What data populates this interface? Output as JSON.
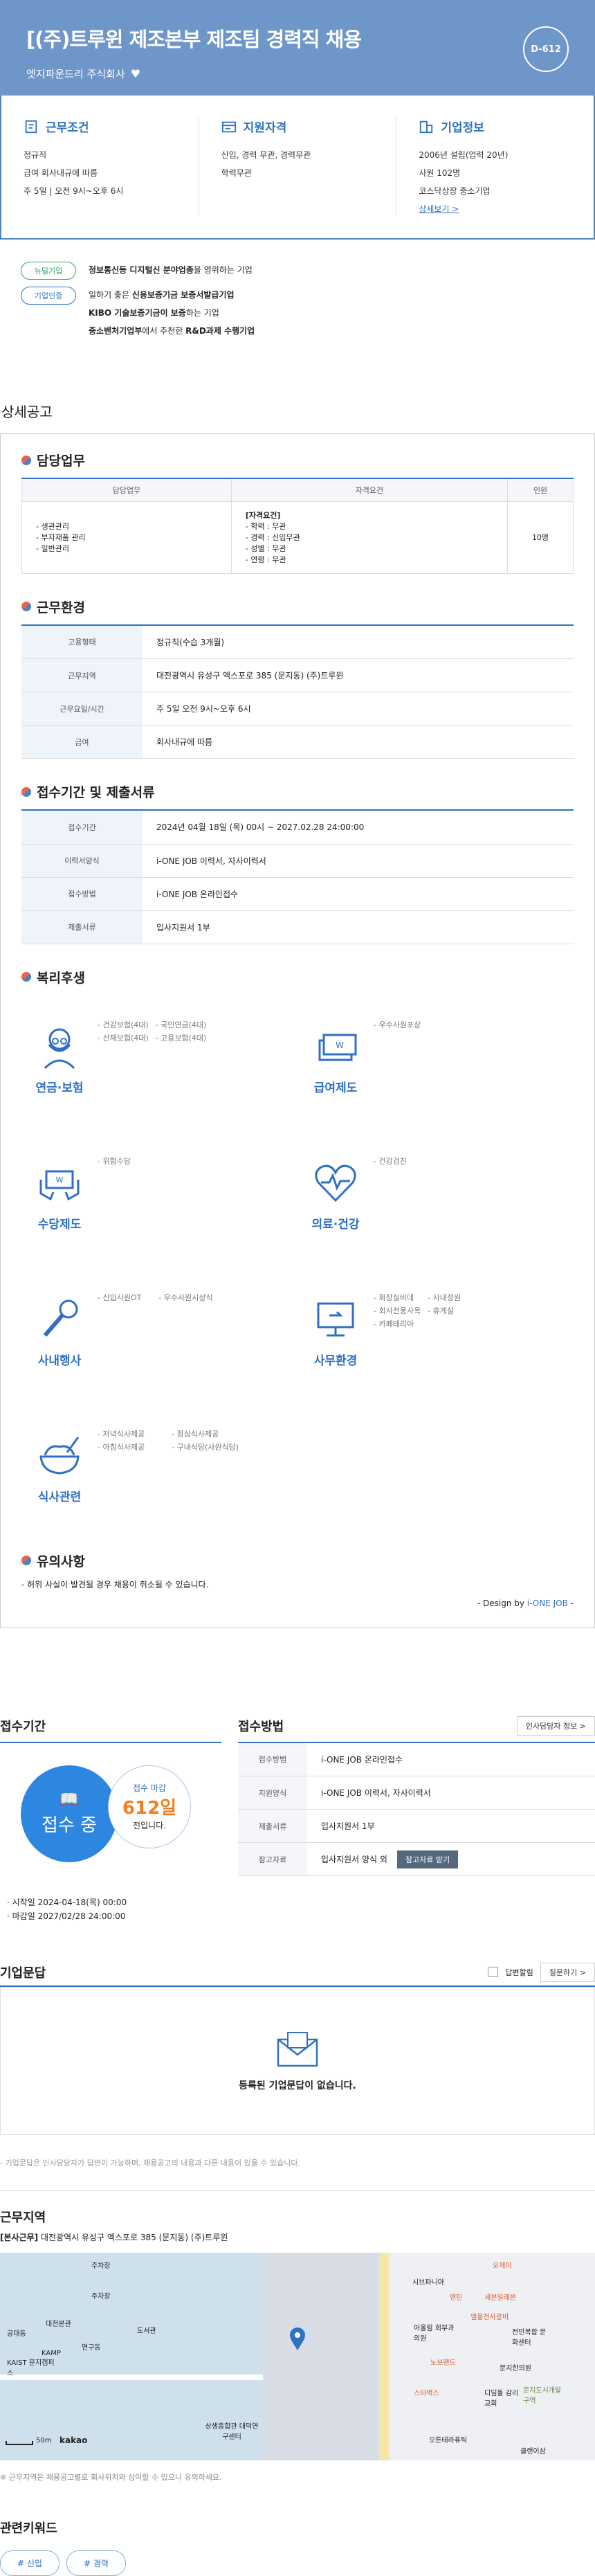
{
  "header": {
    "title": "[(주)트루윈 제조본부 제조팀 경력직 채용",
    "company": "엣지파운드리 주식회사",
    "dday": "D-612"
  },
  "summary": {
    "work": {
      "title": "근무조건",
      "lines": [
        "정규직",
        "급여 회사내규에 따름",
        "주 5일 | 오전 9시~오후 6시"
      ]
    },
    "qual": {
      "title": "지원자격",
      "lines": [
        "신입, 경력 무관, 경력무관",
        "학력무관"
      ]
    },
    "company": {
      "title": "기업정보",
      "lines": [
        "2006년 설립(업력 20년)",
        "사원 102명",
        "코스닥상장 중소기업"
      ],
      "more": "상세보기 >"
    }
  },
  "tags": [
    {
      "pill": "뉴딜기업",
      "lines": [
        {
          "bold": "정보통신등 디지털신 분야업종",
          "rest": "을 영위하는 기업"
        }
      ]
    },
    {
      "pill": "기업인증",
      "lines": [
        {
          "pre": "일하기 좋은 ",
          "bold": "신용보증기금 보증서발급기업",
          "rest": ""
        },
        {
          "pre": "",
          "bold": "KIBO 기술보증기금이 보증",
          "rest": "하는 기업"
        },
        {
          "pre": "",
          "bold": "중소벤처기업부",
          "rest": "에서 추천한 ",
          "bold2": "R&D과제 수행기업"
        }
      ]
    }
  ],
  "detail": {
    "section_title": "상세공고",
    "duty": {
      "title": "담당업무",
      "headers": [
        "담당업무",
        "자격요건",
        "인원"
      ],
      "duties": [
        "- 생관관리",
        "- 부자재품 관리",
        "- 일반관리"
      ],
      "req_title": "[자격요건]",
      "reqs": [
        "- 학력 : 무관",
        "- 경력 : 신입무관",
        "- 성별 : 무관",
        "- 연령 : 무관"
      ],
      "count": "10명"
    },
    "env": {
      "title": "근무환경",
      "rows": [
        {
          "k": "고용형태",
          "v": "정규직(수습 3개월)"
        },
        {
          "k": "근무지역",
          "v": "대전광역시 유성구 엑스포로 385 (문지동) (주)트루윈"
        },
        {
          "k": "근무요일/시간",
          "v": "주 5일 오전 9시~오후 6시"
        },
        {
          "k": "급여",
          "v": "회사내규에 따름"
        }
      ]
    },
    "apply": {
      "title": "접수기간 및 제출서류",
      "rows": [
        {
          "k": "접수기간",
          "v": "2024년 04월 18일 (목) 00시 ~ 2027.02.28 24:00:00"
        },
        {
          "k": "이력서양식",
          "v": "i-ONE JOB 이력서, 자사이력서"
        },
        {
          "k": "접수방법",
          "v": "i-ONE JOB 온라인접수"
        },
        {
          "k": "제출서류",
          "v": "입사지원서 1부"
        }
      ]
    },
    "benefits": {
      "title": "복리후생",
      "items": [
        {
          "label": "연금·보험",
          "icon": "old-man-icon",
          "list": [
            "- 건강보험(4대)",
            "- 국민연금(4대)",
            "- 산재보험(4대)",
            "- 고용보험(4대)"
          ]
        },
        {
          "label": "급여제도",
          "icon": "money-icon",
          "list": [
            "- 우수사원포상"
          ]
        },
        {
          "label": "수당제도",
          "icon": "wallet-hands-icon",
          "list": [
            "- 위험수당"
          ]
        },
        {
          "label": "의료·건강",
          "icon": "heart-pulse-icon",
          "list": [
            "- 건강검진"
          ]
        },
        {
          "label": "사내행사",
          "icon": "microphone-icon",
          "list": [
            "- 신입사원OT",
            "- 우수사원시상식"
          ]
        },
        {
          "label": "사무환경",
          "icon": "monitor-icon",
          "list": [
            "- 화장실비데",
            "- 사내정원",
            "- 회사전용사옥",
            "- 휴게실",
            "- 카페테리아"
          ]
        },
        {
          "label": "식사관련",
          "icon": "rice-bowl-icon",
          "list": [
            "- 저녁식사제공",
            "- 점심식사제공",
            "- 아침식사제공",
            "- 구내식당(사원식당)"
          ]
        }
      ]
    },
    "notice": {
      "title": "유의사항",
      "text": "- 허위 사실이 발견될 경우 채용이 취소될 수 있습니다.",
      "design_pre": "- Design by ",
      "design_brand": "i-ONE JOB",
      "design_post": " -"
    }
  },
  "apply_period": {
    "title": "접수기간",
    "status": "접수 중",
    "deadline_label": "접수 마감",
    "days": "612일",
    "days_suffix": "전입니다.",
    "start": "· 시작일 2024-04-18(목) 00:00",
    "end": "· 마감일 2027/02/28 24:00:00"
  },
  "apply_method": {
    "title": "접수방법",
    "hr_button": "인사담당자 정보  >",
    "rows": [
      {
        "k": "접수방법",
        "v": "i-ONE JOB 온라인접수"
      },
      {
        "k": "지원양식",
        "v": "i-ONE JOB 이력서, 자사이력서"
      },
      {
        "k": "제출서류",
        "v": "입사지원서 1부"
      },
      {
        "k": "참고자료",
        "v": "입사지원서 양식 외"
      }
    ],
    "ref_button": "참고자료 받기"
  },
  "qa": {
    "title": "기업문답",
    "checkbox_label": "답변할림",
    "ask_button": "질문하기  >",
    "empty": "등록된 기업문답이 없습니다.",
    "note": "- 기업문답은 인사담당자가 답변이 가능하며, 채용공고의 내용과 다른 내용이 있을 수 있습니다."
  },
  "location": {
    "title": "근무지역",
    "addr_bold": "[본사근무]",
    "addr": " 대전광역시 유성구 엑스포로 385 (문지동) (주)트루윈",
    "map_labels": [
      "주차장",
      "주차장",
      "대전본관",
      "공대동",
      "도서관",
      "KAIST 문지캠퍼스",
      "연구동",
      "KAMP",
      "상생종합관 대덕연구센터",
      "카카오맵",
      "시브파니아",
      "세븐일레븐",
      "엔틴",
      "오제이",
      "어울림 회부과의원",
      "엠블전사갈비",
      "전민복합 문화센터",
      "노브랜드",
      "문지한의원",
      "스타벅스",
      "디딤돌 감리교회",
      "문지도시개발구역",
      "오튼테라퓨틱",
      "클랜이삼"
    ],
    "scale": "50m",
    "map_brand": "kakao",
    "note": "※ 근무지역은 채용공고별로 회사위치와 상이할 수 있으니 유의하세요."
  },
  "keywords": {
    "title": "관련키워드",
    "items": [
      "# 신입",
      "# 경력"
    ]
  }
}
